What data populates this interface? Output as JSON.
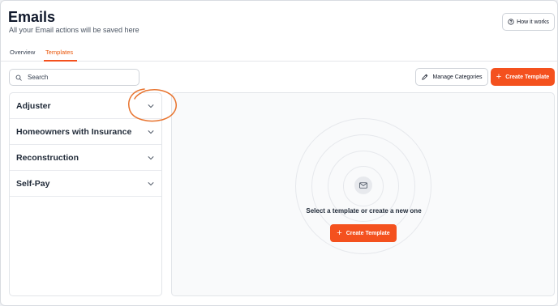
{
  "header": {
    "title": "Emails",
    "subtitle": "All your Email actions will be saved here",
    "how_it_works": "How it works",
    "how_it_works_icon": "help-circle-icon"
  },
  "tabs": [
    {
      "label": "Overview",
      "active": false
    },
    {
      "label": "Templates",
      "active": true
    }
  ],
  "toolbar": {
    "search_placeholder": "Search",
    "search_value": "",
    "manage_label": "Manage Categories",
    "manage_icon": "pencil-icon",
    "create_label": "Create Template",
    "create_icon": "plus-icon"
  },
  "categories": [
    {
      "label": "Adjuster",
      "icon": "chevron-down-icon"
    },
    {
      "label": "Homeowners with Insurance",
      "icon": "chevron-down-icon"
    },
    {
      "label": "Reconstruction",
      "icon": "chevron-down-icon"
    },
    {
      "label": "Self-Pay",
      "icon": "chevron-down-icon"
    }
  ],
  "empty_state": {
    "icon": "mail-icon",
    "text": "Select a template or create a new one",
    "button_label": "Create Template"
  },
  "colors": {
    "accent": "#f4511e",
    "annotation": "#e8742f"
  }
}
